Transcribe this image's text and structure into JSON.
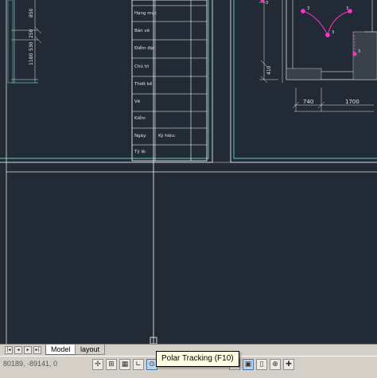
{
  "drawing": {
    "dims_left": [
      "850",
      "250",
      "530",
      "1180"
    ],
    "dims_right_vertical": "410",
    "dims_right_horizontal": [
      "740",
      "1700"
    ],
    "plan_marks": [
      "3",
      "3",
      "3",
      "3",
      "3"
    ],
    "title_block_rows": [
      "Hạng mục",
      "Bản vẽ",
      "Điểm đặt",
      "Chủ trì",
      "Thiết kế",
      "Vẽ",
      "Kiểm",
      "Ngày:",
      "Tỷ lệ:"
    ],
    "title_block_extra": "Ký hiệu:"
  },
  "tabs": {
    "model": "Model",
    "layout": "layout"
  },
  "status": {
    "coordinates": "80189, -89141, 0"
  },
  "tooltip": {
    "text": "Polar Tracking (F10)"
  },
  "colors": {
    "background": "#212a35",
    "highlight": "#ff33cc",
    "accent": "#5fc6c6"
  }
}
